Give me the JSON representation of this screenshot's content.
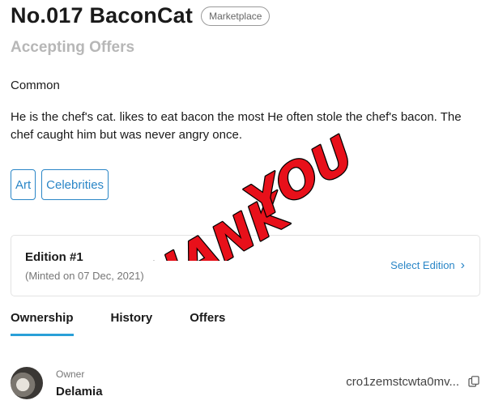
{
  "header": {
    "title": "No.017 BaconCat",
    "marketplace_badge": "Marketplace",
    "status": "Accepting Offers"
  },
  "rarity": "Common",
  "description": "He is the chef's cat. likes to eat bacon the most He often stole the chef's bacon. The chef caught him but was never angry once.",
  "tags": [
    "Art",
    "Celebrities"
  ],
  "edition": {
    "title": "Edition #1",
    "minted": "(Minted on 07 Dec, 2021)",
    "select_label": "Select Edition"
  },
  "tabs": [
    {
      "label": "Ownership",
      "active": true
    },
    {
      "label": "History",
      "active": false
    },
    {
      "label": "Offers",
      "active": false
    }
  ],
  "owner": {
    "label": "Owner",
    "name": "Delamia",
    "address": "cro1zemstcwta0mv..."
  },
  "overlay": {
    "line1": "THANK",
    "line2": "YOU"
  },
  "colors": {
    "accent": "#2a86c7",
    "tab_underline": "#2aa0d8",
    "overlay_red": "#e8101a"
  },
  "icons": {
    "select_edition": "chevron-right-icon",
    "copy": "copy-icon"
  }
}
